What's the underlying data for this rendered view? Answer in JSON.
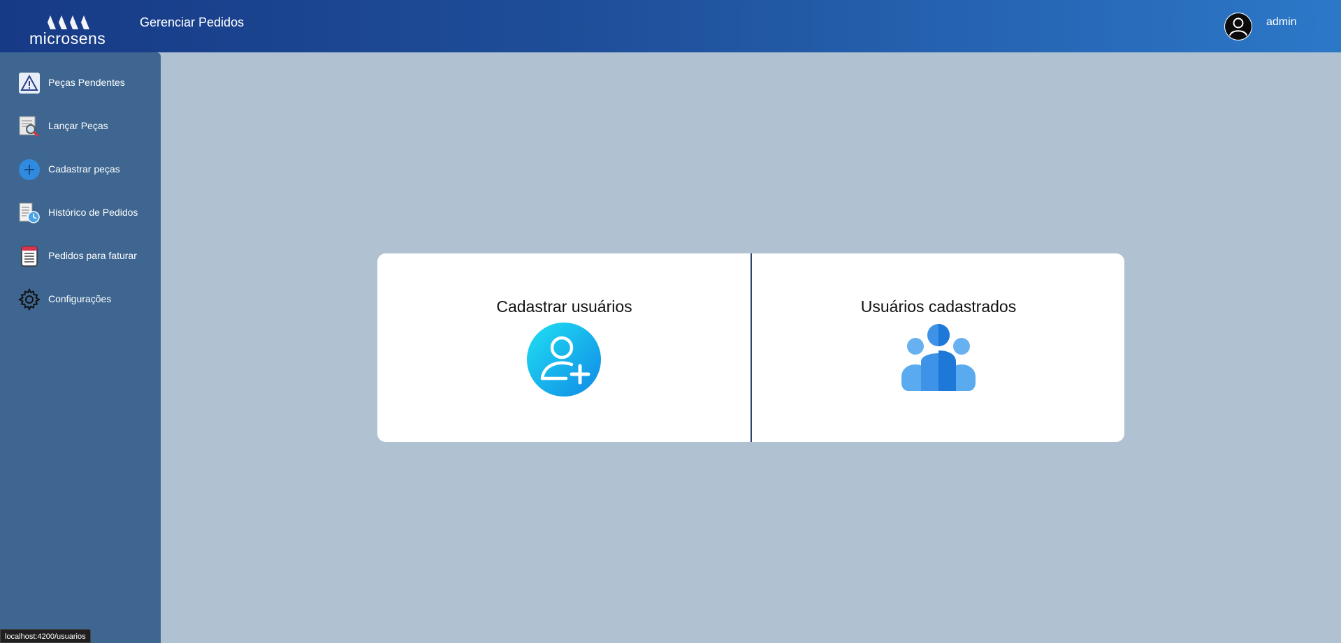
{
  "header": {
    "brand": "microsens",
    "title": "Gerenciar Pedidos",
    "user": "admin"
  },
  "sidebar": {
    "items": [
      {
        "label": "Peças Pendentes",
        "icon": "warning-icon"
      },
      {
        "label": "Lançar Peças",
        "icon": "magnify-document-icon"
      },
      {
        "label": "Cadastrar peças",
        "icon": "plus-circle-icon"
      },
      {
        "label": "Histórico de Pedidos",
        "icon": "history-document-icon"
      },
      {
        "label": "Pedidos para faturar",
        "icon": "invoice-icon"
      },
      {
        "label": "Configurações",
        "icon": "gear-icon"
      }
    ]
  },
  "main": {
    "options": [
      {
        "label": "Cadastrar usuários",
        "icon": "add-user-icon"
      },
      {
        "label": "Usuários cadastrados",
        "icon": "users-group-icon"
      }
    ]
  },
  "statusbar": {
    "url": "localhost:4200/usuarios"
  },
  "colors": {
    "header_start": "#173a86",
    "header_end": "#2c78c8",
    "sidebar": "#3e6690",
    "background": "#b0c1d2",
    "card": "#ffffff"
  }
}
